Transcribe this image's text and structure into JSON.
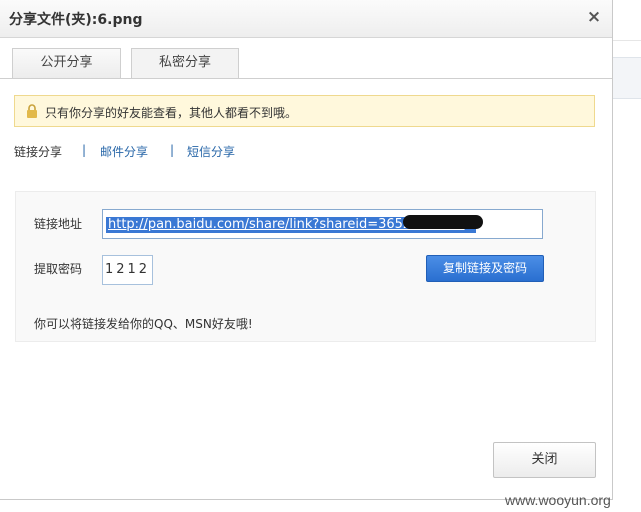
{
  "dialog": {
    "title": "分享文件(夹):6.png",
    "close_icon": "×"
  },
  "tabs": [
    {
      "label": "公开分享",
      "active": false
    },
    {
      "label": "私密分享",
      "active": true
    }
  ],
  "notice": {
    "icon": "lock-icon",
    "text": "只有你分享的好友能查看，其他人都看不到哦。"
  },
  "methods": {
    "link": "链接分享",
    "separator": "|",
    "mail": "邮件分享",
    "sms": "短信分享"
  },
  "share": {
    "url_label": "链接地址",
    "url_value": "http://pan.baidu.com/share/link?shareid=365286&uk=",
    "password_label": "提取密码",
    "password_value": "1212",
    "copy_button": "复制链接及密码",
    "tip": "你可以将链接发给你的QQ、MSN好友哦!"
  },
  "footer": {
    "close_button": "关闭"
  },
  "watermark": "www.wooyun.org",
  "colors": {
    "link": "#2766a8",
    "primary_button": "#2a6fd0",
    "notice_bg": "#fff8dc",
    "selection": "#3a78d4"
  }
}
